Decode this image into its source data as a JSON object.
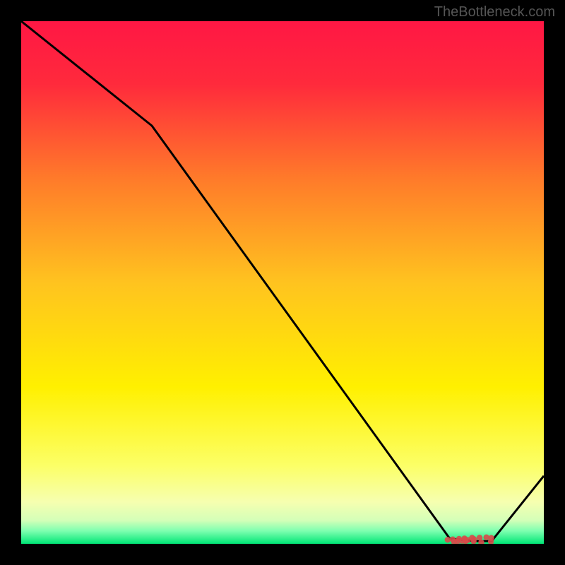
{
  "watermark": "TheBottleneck.com",
  "chart_data": {
    "type": "line",
    "title": "",
    "xlabel": "",
    "ylabel": "",
    "x": [
      0,
      25,
      82,
      87,
      90,
      100
    ],
    "values": [
      100,
      80,
      1,
      0.5,
      0.5,
      13
    ],
    "optimal_range_x": [
      82,
      90
    ],
    "xlim": [
      0,
      100
    ],
    "ylim": [
      0,
      100
    ],
    "background_gradient": {
      "stops": [
        {
          "offset": 0.0,
          "color": "#ff1744"
        },
        {
          "offset": 0.12,
          "color": "#ff2a3c"
        },
        {
          "offset": 0.3,
          "color": "#ff7a2a"
        },
        {
          "offset": 0.5,
          "color": "#ffc31f"
        },
        {
          "offset": 0.7,
          "color": "#fff000"
        },
        {
          "offset": 0.85,
          "color": "#fcff66"
        },
        {
          "offset": 0.92,
          "color": "#f6ffb0"
        },
        {
          "offset": 0.955,
          "color": "#d4ffb8"
        },
        {
          "offset": 0.975,
          "color": "#7fffb0"
        },
        {
          "offset": 1.0,
          "color": "#00e676"
        }
      ]
    },
    "marker_color": "#d84a4a",
    "line_color": "#000000"
  }
}
